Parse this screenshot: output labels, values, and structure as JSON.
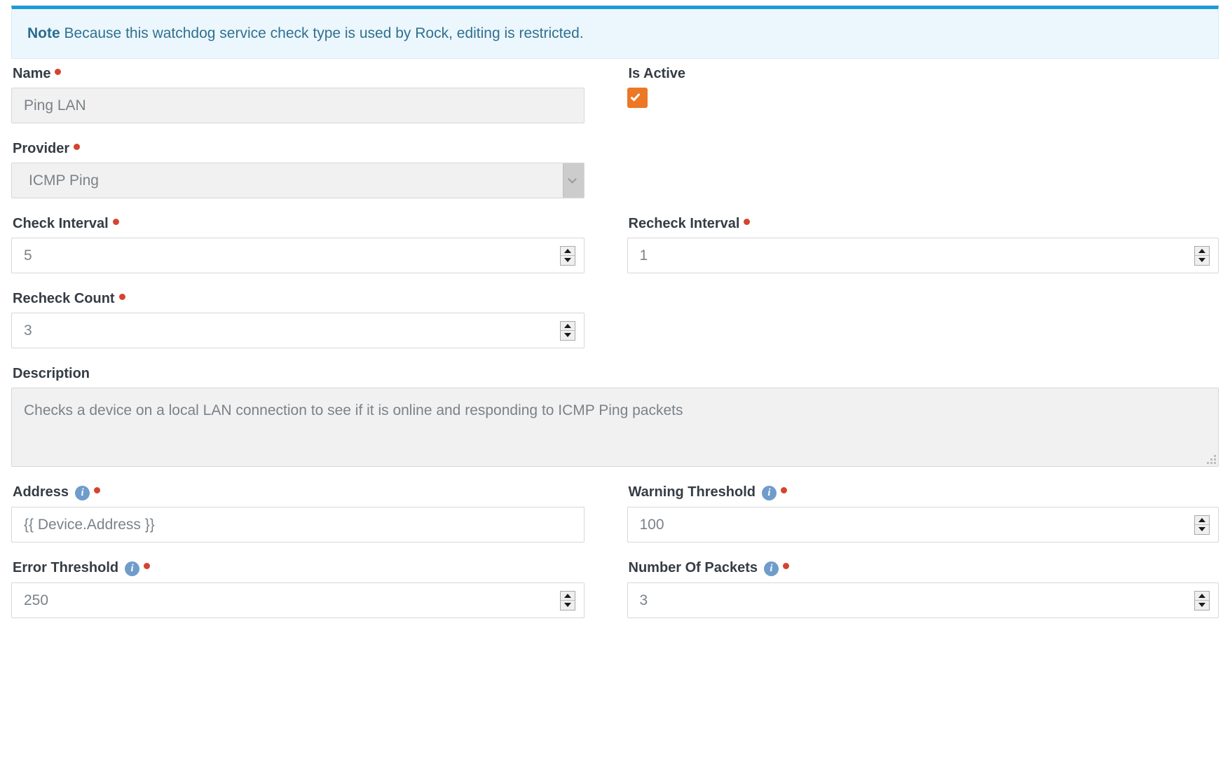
{
  "alert": {
    "strong": "Note",
    "text": " Because this watchdog service check type is used by Rock, editing is restricted."
  },
  "fields": {
    "name": {
      "label": "Name",
      "value": "Ping LAN",
      "required": true,
      "disabled": true
    },
    "is_active": {
      "label": "Is Active",
      "checked": true
    },
    "provider": {
      "label": "Provider",
      "value": "ICMP Ping",
      "required": true,
      "disabled": true,
      "options": [
        "ICMP Ping"
      ]
    },
    "check_interval": {
      "label": "Check Interval",
      "value": "5",
      "required": true
    },
    "recheck_interval": {
      "label": "Recheck Interval",
      "value": "1",
      "required": true
    },
    "recheck_count": {
      "label": "Recheck Count",
      "value": "3",
      "required": true
    },
    "description": {
      "label": "Description",
      "value": "Checks a device on a local LAN connection to see if it is online and responding to ICMP Ping packets",
      "disabled": true
    },
    "address": {
      "label": "Address",
      "value": "{{ Device.Address }}",
      "required": true,
      "info": true
    },
    "warning_threshold": {
      "label": "Warning Threshold",
      "value": "100",
      "required": true,
      "info": true
    },
    "error_threshold": {
      "label": "Error Threshold",
      "value": "250",
      "required": true,
      "info": true
    },
    "number_of_packets": {
      "label": "Number Of Packets",
      "value": "3",
      "required": true,
      "info": true
    }
  },
  "icons": {
    "info": "i",
    "info_name": "info-icon",
    "chevron": "chevron-down-icon",
    "spinner": "number-spinner",
    "check": "check-icon",
    "resize": "resize-grip-icon"
  },
  "colors": {
    "alert_border": "#1e9ad6",
    "alert_bg": "#ebf7fd",
    "required": "#d4442e",
    "checkbox": "#ec7725",
    "info": "#6f9ccb"
  }
}
